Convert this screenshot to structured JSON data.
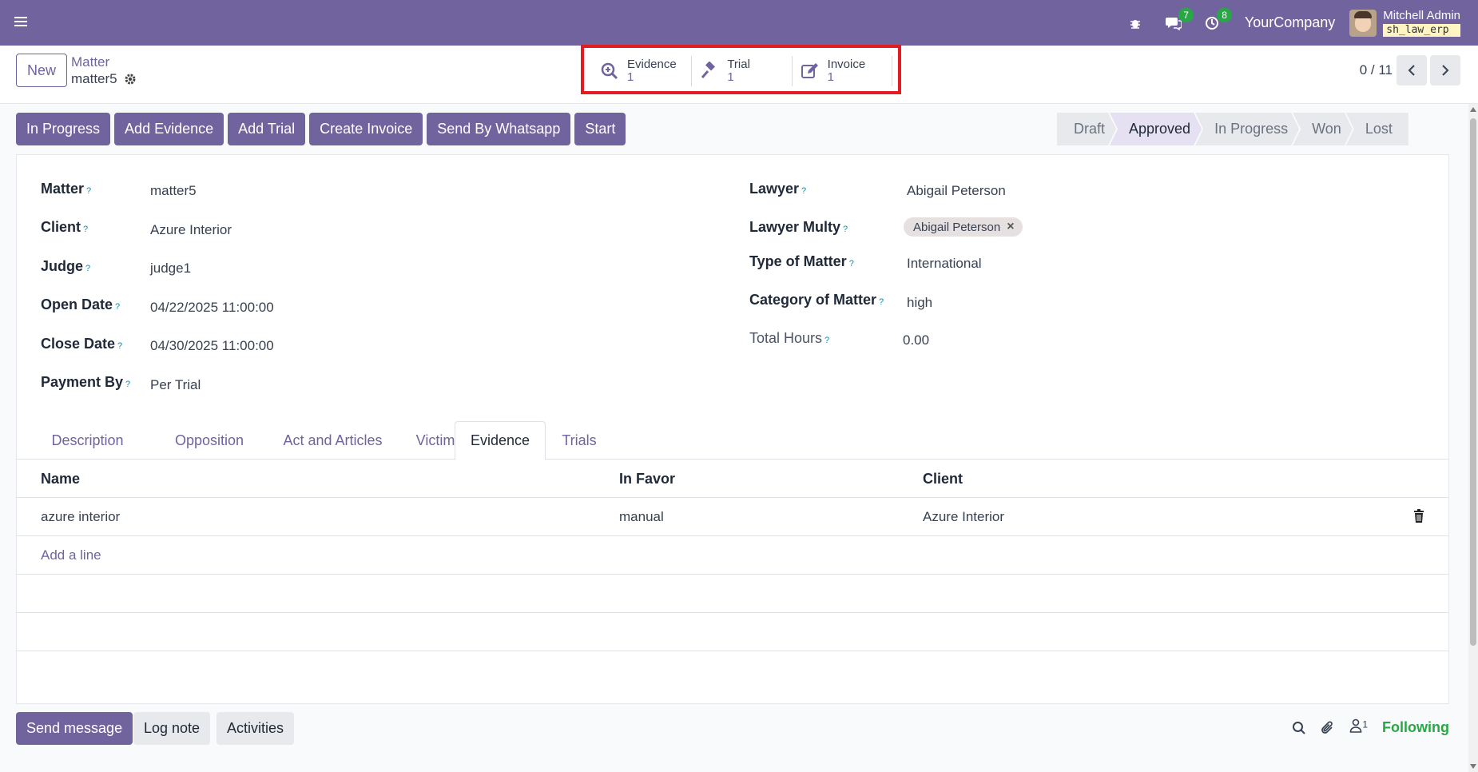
{
  "navbar": {
    "company": "YourCompany",
    "user_name": "Mitchell Admin",
    "db_name": "sh_law_erp",
    "messages_badge": "7",
    "activities_badge": "8",
    "accent": "#71639e"
  },
  "breadcrumb": {
    "new_label": "New",
    "parent": "Matter",
    "current": "matter5"
  },
  "smart_buttons": [
    {
      "label": "Evidence",
      "count": "1",
      "icon": "magnifier-plus-icon"
    },
    {
      "label": "Trial",
      "count": "1",
      "icon": "gavel-icon"
    },
    {
      "label": "Invoice",
      "count": "1",
      "icon": "edit-icon"
    }
  ],
  "pager": {
    "value": "0 / 11"
  },
  "actions": [
    "In Progress",
    "Add Evidence",
    "Add Trial",
    "Create Invoice",
    "Send By Whatsapp",
    "Start"
  ],
  "stages": [
    "Draft",
    "Approved",
    "In Progress",
    "Won",
    "Lost"
  ],
  "active_stage": "Approved",
  "form": {
    "left": [
      {
        "label": "Matter",
        "value": "matter5"
      },
      {
        "label": "Client",
        "value": "Azure Interior"
      },
      {
        "label": "Judge",
        "value": "judge1"
      },
      {
        "label": "Open Date",
        "value": "04/22/2025 11:00:00"
      },
      {
        "label": "Close Date",
        "value": "04/30/2025 11:00:00"
      },
      {
        "label": "Payment By",
        "value": "Per Trial"
      }
    ],
    "right": [
      {
        "label": "Lawyer",
        "value": "Abigail Peterson"
      },
      {
        "label": "Lawyer Multy",
        "value": "Abigail Peterson"
      },
      {
        "label": "Type of Matter",
        "value": "International"
      },
      {
        "label": "Category of Matter",
        "value": "high"
      },
      {
        "label": "Total Hours",
        "value": "0.00"
      }
    ],
    "help_mark": "?"
  },
  "tabs": [
    "Description",
    "Opposition",
    "Act and Articles",
    "Victim",
    "Evidence",
    "Trials"
  ],
  "active_tab": "Evidence",
  "table": {
    "columns": [
      "Name",
      "In Favor",
      "Client"
    ],
    "rows": [
      {
        "name": "azure interior",
        "in_favor": "manual",
        "client": "Azure Interior"
      }
    ],
    "add_line": "Add a line"
  },
  "chatter": {
    "send_message": "Send message",
    "log_note": "Log note",
    "activities": "Activities",
    "followers_count": "1",
    "following": "Following"
  }
}
